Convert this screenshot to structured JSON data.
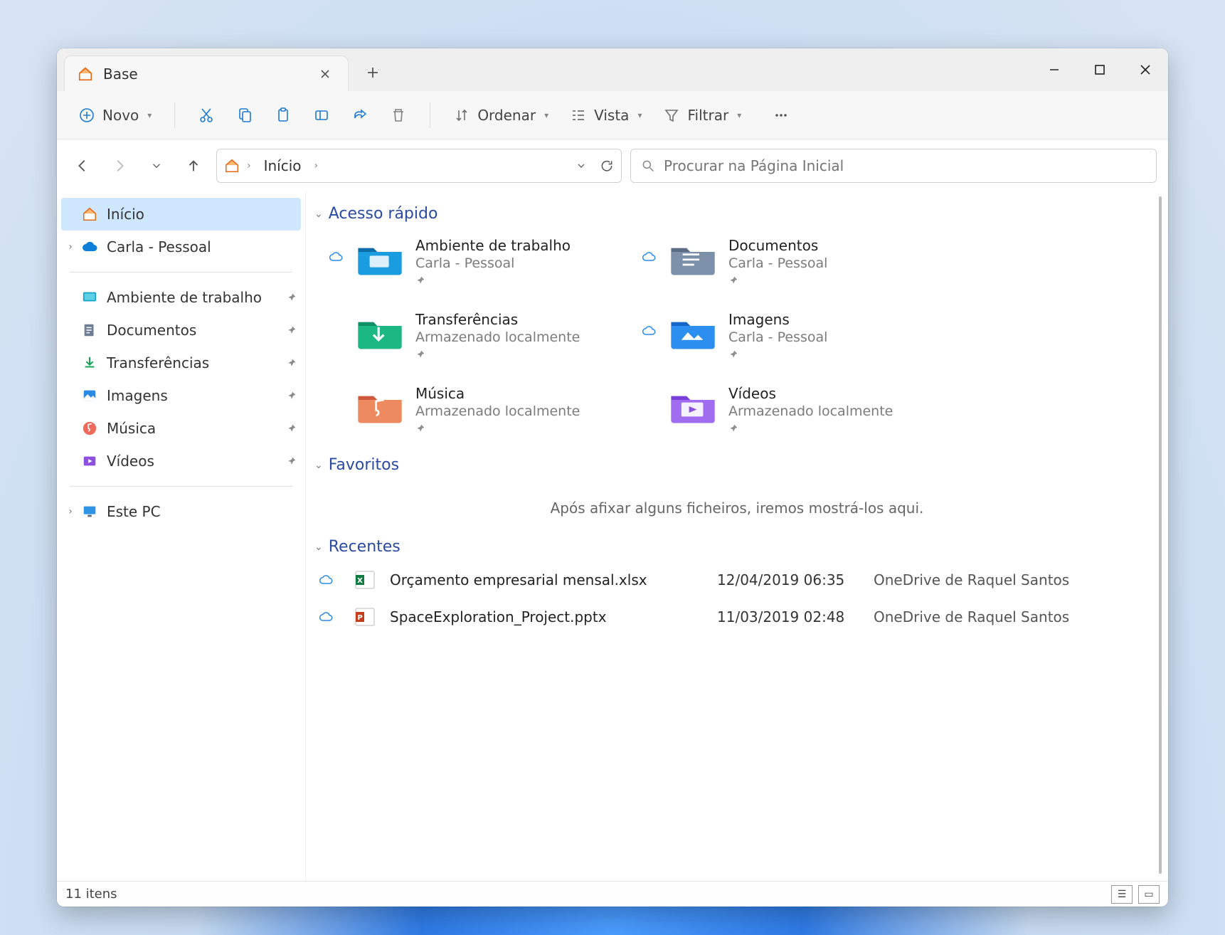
{
  "tab": {
    "title": "Base"
  },
  "toolbar": {
    "new_label": "Novo",
    "sort_label": "Ordenar",
    "view_label": "Vista",
    "filter_label": "Filtrar"
  },
  "breadcrumb": {
    "segment1": "Início"
  },
  "search": {
    "placeholder": "Procurar na Página Inicial"
  },
  "sidebar": {
    "home": "Início",
    "onedrive": "Carla - Pessoal",
    "desktop": "Ambiente de trabalho",
    "documents": "Documentos",
    "downloads": "Transferências",
    "pictures": "Imagens",
    "music": "Música",
    "videos": "Vídeos",
    "thispc": "Este PC"
  },
  "sections": {
    "quick_access": "Acesso rápido",
    "favorites": "Favoritos",
    "recent": "Recentes"
  },
  "quick_access": [
    {
      "name": "Ambiente de trabalho",
      "sub": "Carla - Pessoal",
      "cloud": true,
      "kind": "desktop"
    },
    {
      "name": "Documentos",
      "sub": "Carla - Pessoal",
      "cloud": true,
      "kind": "documents"
    },
    {
      "name": "Transferências",
      "sub": "Armazenado localmente",
      "cloud": false,
      "kind": "downloads"
    },
    {
      "name": "Imagens",
      "sub": "Carla - Pessoal",
      "cloud": true,
      "kind": "pictures"
    },
    {
      "name": "Música",
      "sub": "Armazenado localmente",
      "cloud": false,
      "kind": "music"
    },
    {
      "name": "Vídeos",
      "sub": "Armazenado localmente",
      "cloud": false,
      "kind": "videos"
    }
  ],
  "favorites_empty": "Após afixar alguns ficheiros, iremos mostrá-los aqui.",
  "recent": [
    {
      "name": "Orçamento empresarial mensal.xlsx",
      "date": "12/04/2019 06:35",
      "location": "OneDrive de Raquel Santos",
      "kind": "xlsx",
      "cloud": true
    },
    {
      "name": "SpaceExploration_Project.pptx",
      "date": "11/03/2019 02:48",
      "location": "OneDrive de Raquel Santos",
      "kind": "pptx",
      "cloud": true
    }
  ],
  "status": {
    "items": "11 itens"
  }
}
